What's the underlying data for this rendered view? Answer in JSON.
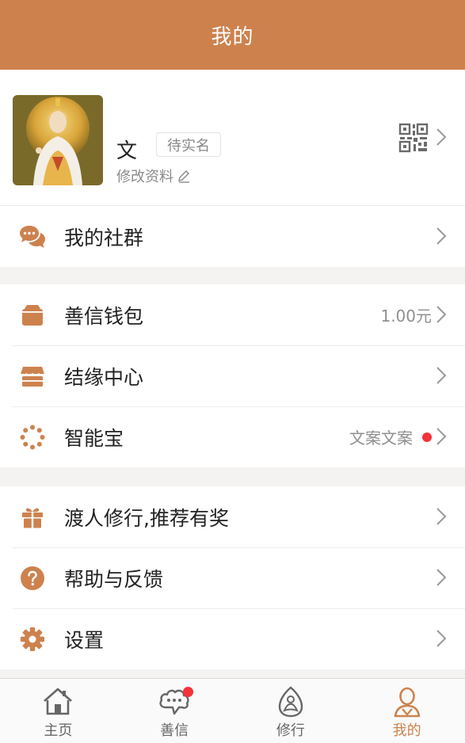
{
  "header": {
    "title": "我的"
  },
  "profile": {
    "name": "文",
    "verify_status": "待实名",
    "edit_label": "修改资料",
    "qr_icon": "qr-code-icon"
  },
  "menu_groups": [
    {
      "items": [
        {
          "key": "community",
          "icon": "chat-bubbles-icon",
          "label": "我的社群",
          "value": "",
          "dot": false
        }
      ]
    },
    {
      "items": [
        {
          "key": "wallet",
          "icon": "wallet-icon",
          "label": "善信钱包",
          "value": "1.00元",
          "dot": false
        },
        {
          "key": "karma",
          "icon": "store-icon",
          "label": "结缘中心",
          "value": "",
          "dot": false
        },
        {
          "key": "smart",
          "icon": "prayer-beads-icon",
          "label": "智能宝",
          "value": "文案文案",
          "dot": true
        }
      ]
    },
    {
      "items": [
        {
          "key": "referral",
          "icon": "gift-icon",
          "label": "渡人修行,推荐有奖",
          "value": "",
          "dot": false
        },
        {
          "key": "help",
          "icon": "question-icon",
          "label": "帮助与反馈",
          "value": "",
          "dot": false
        },
        {
          "key": "settings",
          "icon": "gear-icon",
          "label": "设置",
          "value": "",
          "dot": false
        }
      ]
    }
  ],
  "tabbar": {
    "tabs": [
      {
        "label": "主页",
        "icon": "home-icon",
        "active": false,
        "badge": false
      },
      {
        "label": "善信",
        "icon": "chat-cloud-icon",
        "active": false,
        "badge": true
      },
      {
        "label": "修行",
        "icon": "meditation-icon",
        "active": false,
        "badge": false
      },
      {
        "label": "我的",
        "icon": "monk-icon",
        "active": true,
        "badge": false
      }
    ]
  },
  "colors": {
    "accent": "#cd824e",
    "badge": "#f2333a",
    "background": "#f4f3f1"
  }
}
